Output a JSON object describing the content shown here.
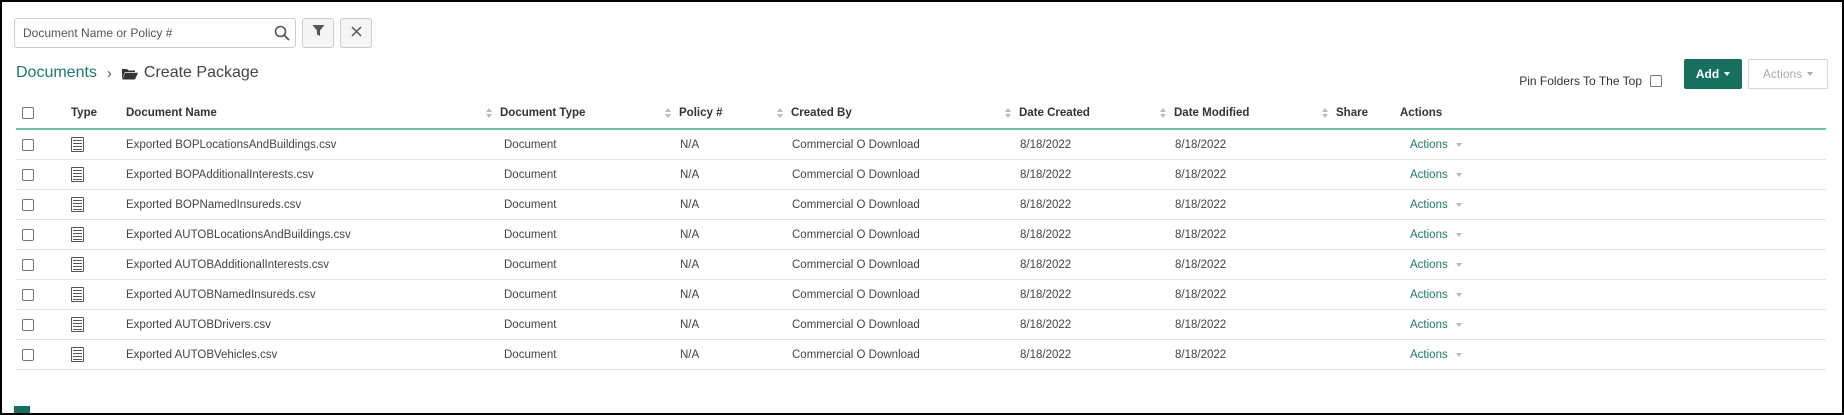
{
  "search": {
    "placeholder": "Document Name or Policy #"
  },
  "breadcrumb": {
    "root": "Documents",
    "separator": "›",
    "current": "Create Package"
  },
  "toolbar": {
    "pin_label": "Pin Folders To The Top",
    "pin_checked": false,
    "add_label": "Add",
    "actions_label": "Actions"
  },
  "table": {
    "headers": {
      "type": "Type",
      "name": "Document Name",
      "doc_type": "Document Type",
      "policy": "Policy #",
      "created_by": "Created By",
      "date_created": "Date Created",
      "date_modified": "Date Modified",
      "share": "Share",
      "actions": "Actions"
    },
    "rows": [
      {
        "name": "Exported BOPLocationsAndBuildings.csv",
        "doc_type": "Document",
        "policy": "N/A",
        "created_by": "Commercial O Download",
        "date_created": "8/18/2022",
        "date_modified": "8/18/2022",
        "actions": "Actions"
      },
      {
        "name": "Exported BOPAdditionalInterests.csv",
        "doc_type": "Document",
        "policy": "N/A",
        "created_by": "Commercial O Download",
        "date_created": "8/18/2022",
        "date_modified": "8/18/2022",
        "actions": "Actions"
      },
      {
        "name": "Exported BOPNamedInsureds.csv",
        "doc_type": "Document",
        "policy": "N/A",
        "created_by": "Commercial O Download",
        "date_created": "8/18/2022",
        "date_modified": "8/18/2022",
        "actions": "Actions"
      },
      {
        "name": "Exported AUTOBLocationsAndBuildings.csv",
        "doc_type": "Document",
        "policy": "N/A",
        "created_by": "Commercial O Download",
        "date_created": "8/18/2022",
        "date_modified": "8/18/2022",
        "actions": "Actions"
      },
      {
        "name": "Exported AUTOBAdditionalInterests.csv",
        "doc_type": "Document",
        "policy": "N/A",
        "created_by": "Commercial O Download",
        "date_created": "8/18/2022",
        "date_modified": "8/18/2022",
        "actions": "Actions"
      },
      {
        "name": "Exported AUTOBNamedInsureds.csv",
        "doc_type": "Document",
        "policy": "N/A",
        "created_by": "Commercial O Download",
        "date_created": "8/18/2022",
        "date_modified": "8/18/2022",
        "actions": "Actions"
      },
      {
        "name": "Exported AUTOBDrivers.csv",
        "doc_type": "Document",
        "policy": "N/A",
        "created_by": "Commercial O Download",
        "date_created": "8/18/2022",
        "date_modified": "8/18/2022",
        "actions": "Actions"
      },
      {
        "name": "Exported AUTOBVehicles.csv",
        "doc_type": "Document",
        "policy": "N/A",
        "created_by": "Commercial O Download",
        "date_created": "8/18/2022",
        "date_modified": "8/18/2022",
        "actions": "Actions"
      }
    ]
  },
  "colors": {
    "accent": "#16705d",
    "link": "#1c7a68",
    "header_rule": "#6cbfa8"
  },
  "icons": {
    "search": "search-icon",
    "filter": "filter-icon",
    "clear": "close-icon",
    "folder": "folder-open-icon",
    "document": "document-icon",
    "sort": "sort-icon"
  }
}
